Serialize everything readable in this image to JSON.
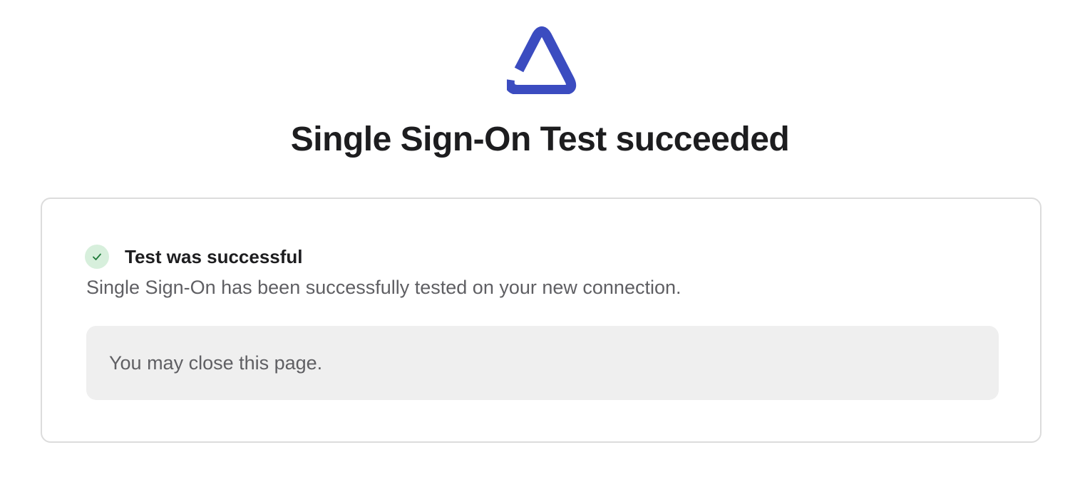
{
  "brand": {
    "logo_icon": "triangle-logo-icon",
    "accent_color": "#3b4cc0"
  },
  "header": {
    "title": "Single Sign-On Test succeeded"
  },
  "result_card": {
    "status_icon": "check-icon",
    "status_color": "#1f7a3a",
    "status_title": "Test was successful",
    "status_description": "Single Sign-On has been successfully tested on your new connection.",
    "notice_text": "You may close this page."
  }
}
